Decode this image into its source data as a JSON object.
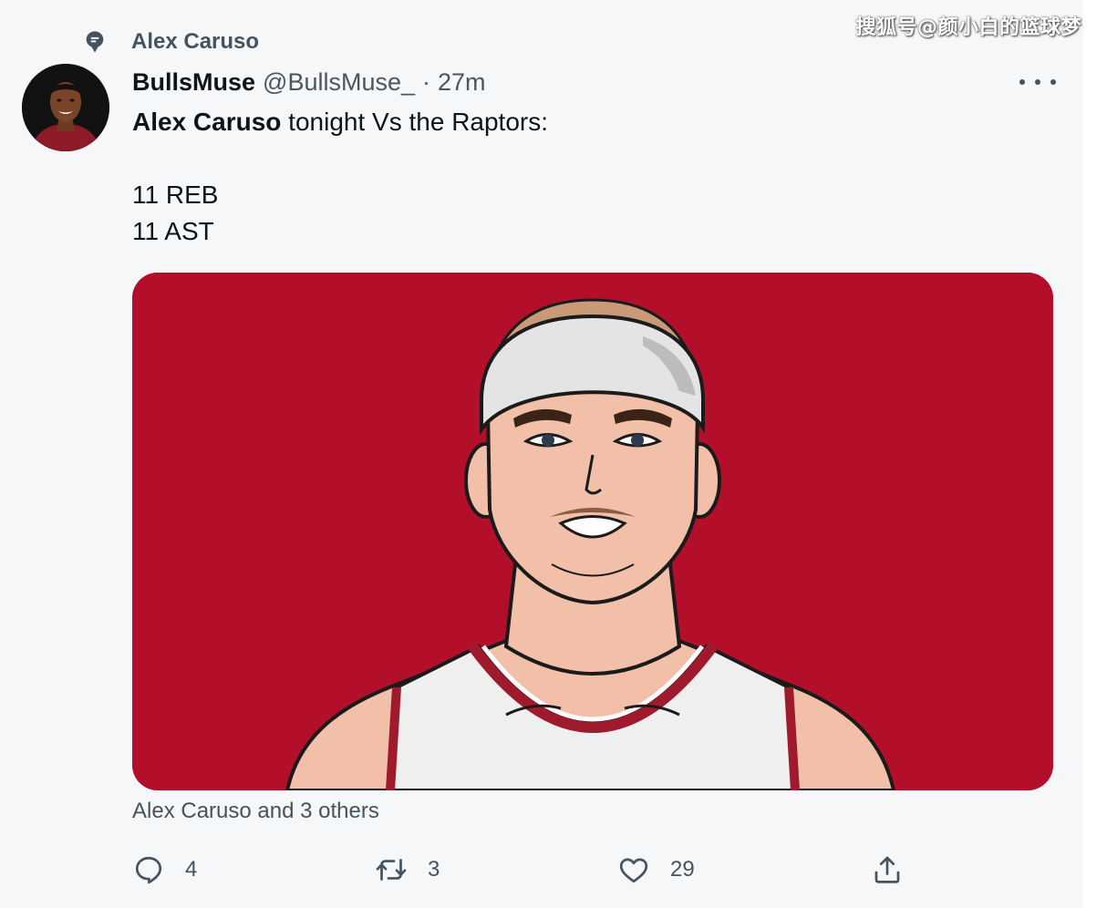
{
  "watermark": "搜狐号@颜小白的篮球梦",
  "social_context": {
    "label": "Alex Caruso",
    "icon": "topic-icon"
  },
  "tweet": {
    "display_name": "BullsMuse",
    "handle": "@BullsMuse_",
    "separator": "·",
    "time": "27m",
    "text": {
      "mention": "Alex Caruso",
      "rest": " tonight Vs the Raptors:",
      "line2": "11 REB",
      "line3": "11 AST"
    },
    "media": {
      "description_icon": "player-illustration",
      "background_color": "#b30f2b"
    },
    "tagged": "Alex Caruso and 3 others",
    "actions": {
      "reply": {
        "icon": "reply-icon",
        "count": "4"
      },
      "retweet": {
        "icon": "retweet-icon",
        "count": "3"
      },
      "like": {
        "icon": "heart-icon",
        "count": "29"
      },
      "share": {
        "icon": "share-icon"
      }
    }
  },
  "colors": {
    "text_primary": "#0f1419",
    "text_secondary": "#44535f",
    "media_bg": "#b30f2b"
  }
}
